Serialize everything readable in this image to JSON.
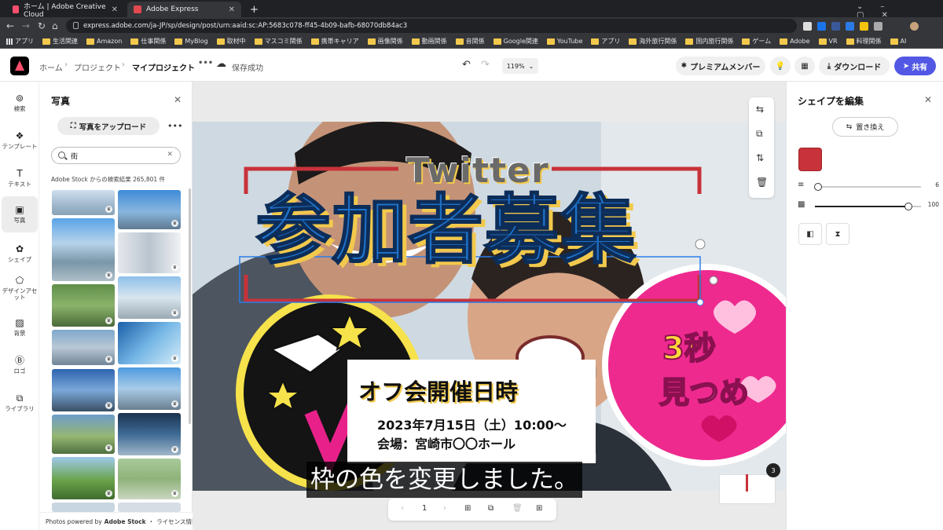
{
  "browser": {
    "tabs": [
      {
        "label": "ホーム | Adobe Creative Cloud"
      },
      {
        "label": "Adobe Express"
      }
    ],
    "url": "express.adobe.com/ja-JP/sp/design/post/urn:aaid:sc:AP:5683c078-ff45-4b09-bafb-68070db84ac3",
    "bookmarks": [
      "アプリ",
      "生活関連",
      "Amazon",
      "仕事関係",
      "MyBlog",
      "取材中",
      "マスコミ関係",
      "携帯キャリア",
      "画像関係",
      "動画関係",
      "音関係",
      "Google関連",
      "YouTube",
      "アプリ",
      "海外旅行関係",
      "国内旅行関係",
      "ゲーム",
      "Adobe",
      "VR",
      "料理関係",
      "AI"
    ]
  },
  "header": {
    "crumbs": [
      "ホーム",
      "プロジェクト",
      "マイプロジェクト"
    ],
    "save_status": "保存成功",
    "zoom": "119%",
    "premium_label": "プレミアムメンバー",
    "download_label": "ダウンロード",
    "share_label": "共有"
  },
  "rail": [
    {
      "label": "検索"
    },
    {
      "label": "テンプレート"
    },
    {
      "label": "テキスト"
    },
    {
      "label": "写真"
    },
    {
      "label": "シェイプ"
    },
    {
      "label": "デザインアセット"
    },
    {
      "label": "背景"
    },
    {
      "label": "ロゴ"
    },
    {
      "label": "ライブラリ"
    }
  ],
  "photo_panel": {
    "title": "写真",
    "upload_label": "写真をアップロード",
    "search_value": "街",
    "result_count": "Adobe Stock からの検索結果 265,801 件",
    "credits_prefix": "Photos powered by",
    "credits_brand": "Adobe Stock",
    "credits_sep": "・",
    "credits_link": "ライセンス情報"
  },
  "design": {
    "twitter_title": "Twitter",
    "main_title": "参加者募集",
    "event_title": "オフ会開催日時",
    "event_date": "2023年7月15日（土）10:00〜",
    "event_venue": "会場：宮崎市〇〇ホール",
    "sign_text_right_1": "3秒",
    "sign_text_right_2": "見つめ",
    "frame_color": "#c8323a"
  },
  "subtitle": "枠の色を変更しました。",
  "pager": {
    "page": "1",
    "page_badge": "3"
  },
  "shape_panel": {
    "title": "シェイプを編集",
    "replace_label": "置き換え",
    "fill_color": "#c8323a",
    "stroke_width": "6",
    "opacity": "100"
  }
}
